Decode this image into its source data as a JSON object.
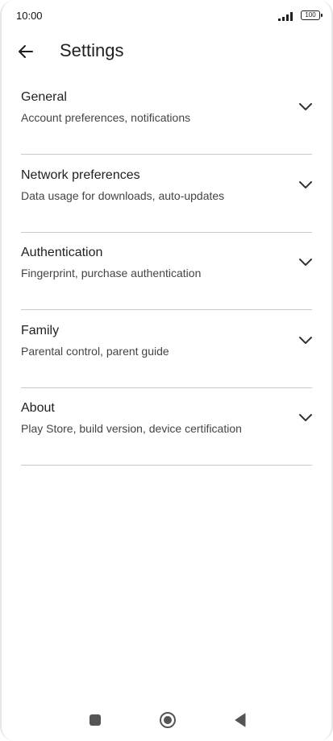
{
  "status_bar": {
    "time": "10:00",
    "battery": "100"
  },
  "app_bar": {
    "title": "Settings",
    "back_icon": "arrow-back-icon"
  },
  "sections": [
    {
      "title": "General",
      "subtitle": "Account preferences, notifications"
    },
    {
      "title": "Network preferences",
      "subtitle": "Data usage for downloads, auto-updates"
    },
    {
      "title": "Authentication",
      "subtitle": "Fingerprint, purchase authentication"
    },
    {
      "title": "Family",
      "subtitle": "Parental control, parent guide"
    },
    {
      "title": "About",
      "subtitle": "Play Store, build version, device certification"
    }
  ],
  "nav_bar": {
    "recents_icon": "square-icon",
    "home_icon": "circle-icon",
    "back_icon": "triangle-back-icon"
  }
}
